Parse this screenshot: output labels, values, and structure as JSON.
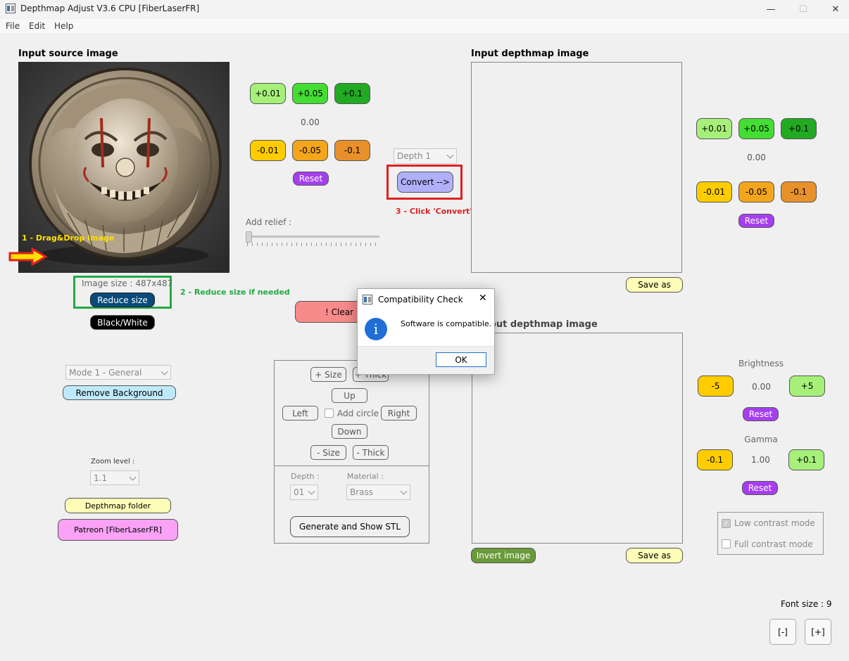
{
  "window": {
    "title": "Depthmap Adjust V3.6 CPU [FiberLaserFR]",
    "minimize": "—",
    "maximize": "☐",
    "close": "✕"
  },
  "menu": [
    "File",
    "Edit",
    "Help"
  ],
  "left": {
    "input_title": "Input source image",
    "drag_hint": "1 - Drag&Drop image",
    "image_size": "Image size : 487x487",
    "reduce_size": "Reduce size",
    "reduce_hint": "2 - Reduce size if needed",
    "black_white": "Black/White",
    "mode_select": "Mode 1 - General",
    "remove_bg": "Remove Background",
    "zoom_label": "Zoom level :",
    "zoom_value": "1.1",
    "depthmap_folder": "Depthmap folder",
    "patreon": "Patreon [FiberLaserFR]"
  },
  "adjust1": {
    "plus": [
      "+0.01",
      "+0.05",
      "+0.1"
    ],
    "value": "0.00",
    "minus": [
      "-0.01",
      "-0.05",
      "-0.1"
    ],
    "reset": "Reset",
    "relief_label": "Add relief :",
    "relief_value": 0
  },
  "convert": {
    "depth_select": "Depth 1",
    "convert_button": "Convert -->",
    "hint": "3 - Click 'Convert'"
  },
  "clear_button": "!   Clear",
  "circle": {
    "plus_size": "+ Size",
    "plus_thick": "+ Thick",
    "up": "Up",
    "left": "Left",
    "add_circle": "Add circle",
    "right": "Right",
    "down": "Down",
    "minus_size": "- Size",
    "minus_thick": "- Thick",
    "depth_label": "Depth :",
    "depth_value": "01",
    "material_label": "Material :",
    "material_value": "Brass",
    "generate": "Generate and Show STL"
  },
  "depthmap_input": {
    "title": "Input depthmap image",
    "save_as": "Save as"
  },
  "depthmap_output": {
    "title": "Output depthmap image",
    "invert": "Invert image",
    "save_as": "Save as"
  },
  "adjust2": {
    "plus": [
      "+0.01",
      "+0.05",
      "+0.1"
    ],
    "value": "0.00",
    "minus": [
      "-0.01",
      "-0.05",
      "-0.1"
    ],
    "reset": "Reset"
  },
  "brightness": {
    "label": "Brightness",
    "minus": "-5",
    "value": "0.00",
    "plus": "+5",
    "reset": "Reset"
  },
  "gamma": {
    "label": "Gamma",
    "minus": "-0.1",
    "value": "1.00",
    "plus": "+0.1",
    "reset": "Reset"
  },
  "contrast": {
    "low": "Low contrast mode",
    "full": "Full contrast mode"
  },
  "font": {
    "label": "Font size : 9",
    "minus": "[-]",
    "plus": "[+]"
  },
  "dialog": {
    "title": "Compatibility Check",
    "message": "Software is compatible.",
    "ok": "OK",
    "info_icon": "i"
  },
  "colors": {
    "light_green": "#a6f07a",
    "mid_green": "#44dd33",
    "dark_green": "#22aa22",
    "yellow": "#ffcc00",
    "orange_light": "#f3a51c",
    "orange": "#e8902a",
    "purple": "#a63ef0",
    "convert_blue": "#b0b0f8",
    "reduce_blue": "#0a4a7a",
    "annot_red": "#e02020",
    "annot_green": "#22aa44",
    "annot_yellow": "#ffe000"
  }
}
